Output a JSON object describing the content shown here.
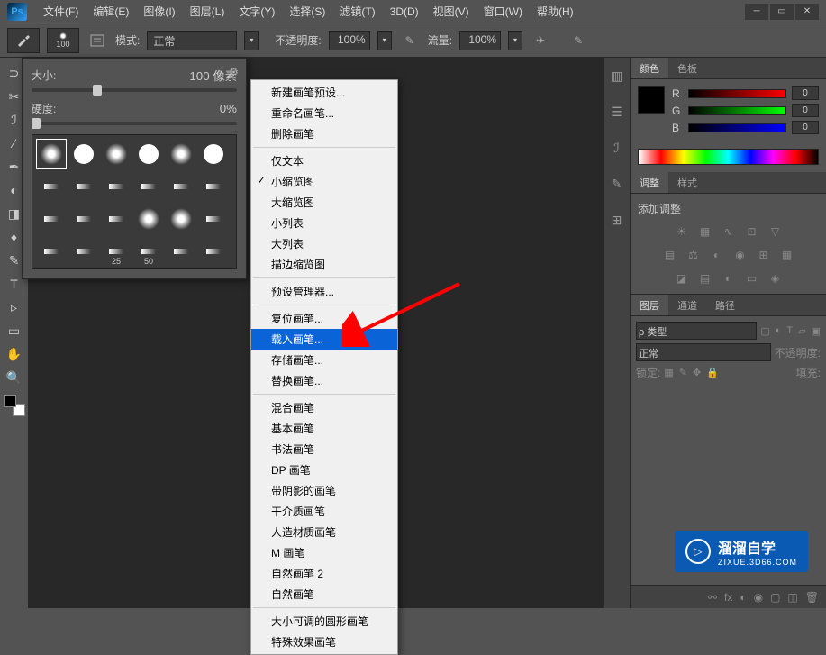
{
  "menu": {
    "items": [
      "文件(F)",
      "编辑(E)",
      "图像(I)",
      "图层(L)",
      "文字(Y)",
      "选择(S)",
      "滤镜(T)",
      "3D(D)",
      "视图(V)",
      "窗口(W)",
      "帮助(H)"
    ]
  },
  "options": {
    "brush_size": "100",
    "mode_label": "模式:",
    "mode_value": "正常",
    "opacity_label": "不透明度:",
    "opacity_value": "100%",
    "flow_label": "流量:",
    "flow_value": "100%"
  },
  "brush_popup": {
    "size_label": "大小:",
    "size_value": "100 像素",
    "hardness_label": "硬度:",
    "hardness_value": "0%",
    "thumb_25": "25",
    "thumb_50": "50"
  },
  "context_menu": {
    "groups": [
      [
        "新建画笔预设...",
        "重命名画笔...",
        "删除画笔"
      ],
      [
        "仅文本",
        "小缩览图",
        "大缩览图",
        "小列表",
        "大列表",
        "描边缩览图"
      ],
      [
        "预设管理器..."
      ],
      [
        "复位画笔...",
        "载入画笔...",
        "存储画笔...",
        "替换画笔..."
      ],
      [
        "混合画笔",
        "基本画笔",
        "书法画笔",
        "DP 画笔",
        "带阴影的画笔",
        "干介质画笔",
        "人造材质画笔",
        "M 画笔",
        "自然画笔 2",
        "自然画笔"
      ],
      [
        "大小可调的圆形画笔",
        "特殊效果画笔"
      ]
    ],
    "checked": "小缩览图",
    "highlighted": "载入画笔..."
  },
  "panels": {
    "color_tab": "颜色",
    "swatches_tab": "色板",
    "r_label": "R",
    "g_label": "G",
    "b_label": "B",
    "r_val": "0",
    "g_val": "0",
    "b_val": "0",
    "adjustments_tab": "调整",
    "styles_tab": "样式",
    "add_adjustment": "添加调整",
    "layers_tab": "图层",
    "channels_tab": "通道",
    "paths_tab": "路径",
    "kind_label": "ρ 类型",
    "blend_mode": "正常",
    "opacity_label": "不透明度:",
    "lock_label": "锁定:",
    "fill_label": "填充:"
  },
  "watermark": {
    "title": "溜溜自学",
    "url": "ZIXUE.3D66.COM"
  }
}
